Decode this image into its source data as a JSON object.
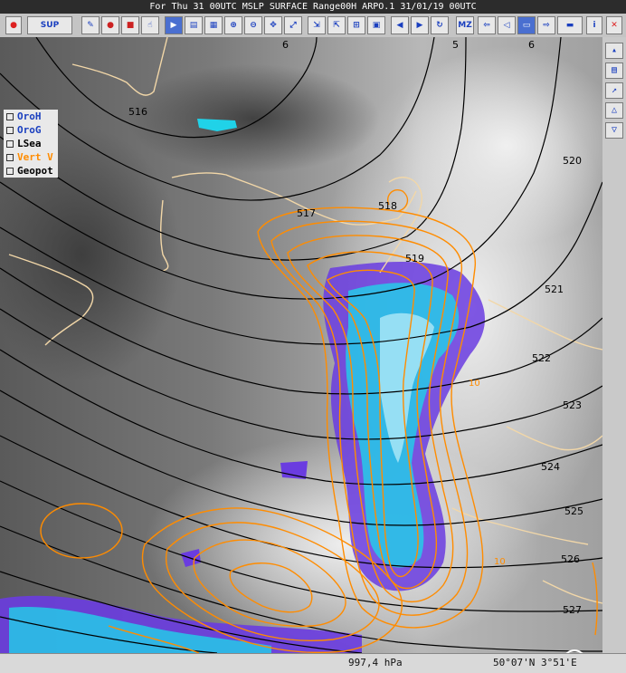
{
  "window": {
    "title": "For Thu 31 00UTC MSLP SURFACE Range00H ARPO.1 31/01/19 00UTC"
  },
  "toolbar": {
    "sup_label": "SUP",
    "mz_label": "MZ"
  },
  "legend": {
    "items": [
      {
        "label": "OroH",
        "color": "#1a3fbf"
      },
      {
        "label": "OroG",
        "color": "#1a3fbf"
      },
      {
        "label": "LSea",
        "color": "#000000"
      },
      {
        "label": "Vert V",
        "color": "#ff8c00"
      },
      {
        "label": "Geopot",
        "color": "#000000"
      }
    ]
  },
  "map": {
    "contour_labels": [
      "516",
      "517",
      "518",
      "519",
      "520",
      "521",
      "522",
      "523",
      "524",
      "525",
      "526",
      "527"
    ],
    "top_labels": [
      "6",
      "5",
      "6"
    ],
    "vertv_labels": [
      "10",
      "10"
    ]
  },
  "status": {
    "pressure": "997,4 hPa",
    "coords": "50°07'N 3°51'E"
  },
  "compass": {
    "label": "N"
  }
}
